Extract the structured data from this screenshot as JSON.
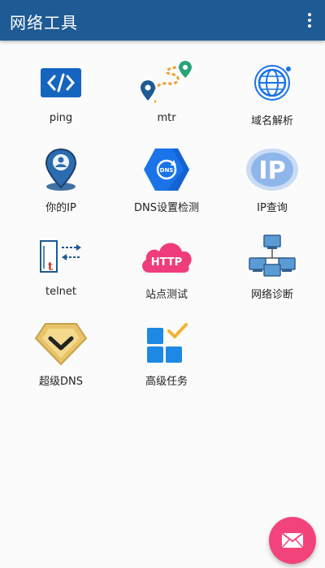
{
  "header": {
    "title": "网络工具",
    "menu_icon": "more-vert-icon"
  },
  "tools": [
    {
      "label": "ping",
      "icon": "code-icon"
    },
    {
      "label": "mtr",
      "icon": "route-icon"
    },
    {
      "label": "域名解析",
      "icon": "globe-icon"
    },
    {
      "label": "你的IP",
      "icon": "location-pin-icon"
    },
    {
      "label": "DNS设置检测",
      "icon": "dns-refresh-icon"
    },
    {
      "label": "IP查询",
      "icon": "ip-badge-icon"
    },
    {
      "label": "telnet",
      "icon": "telnet-icon"
    },
    {
      "label": "站点测试",
      "icon": "http-cloud-icon"
    },
    {
      "label": "网络诊断",
      "icon": "network-computers-icon"
    },
    {
      "label": "超级DNS",
      "icon": "chevron-badge-icon"
    },
    {
      "label": "高级任务",
      "icon": "task-grid-icon"
    }
  ],
  "fab": {
    "icon": "mail-icon"
  },
  "colors": {
    "appbar": "#1e5a94",
    "fab": "#f2447a",
    "accent_blue": "#1a73e8"
  }
}
